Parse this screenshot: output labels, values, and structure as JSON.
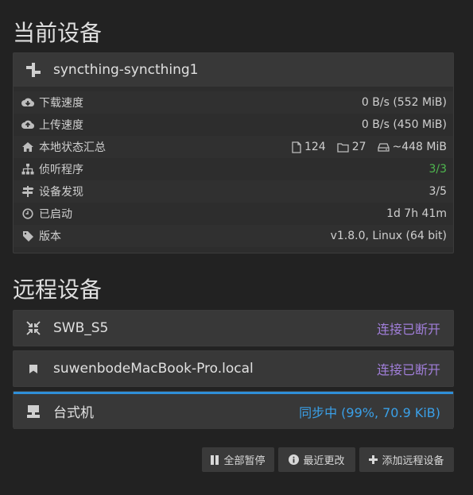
{
  "this_device": {
    "section_title": "当前设备",
    "name": "syncthing-syncthing1",
    "rows": [
      {
        "icon": "cloud-download-icon",
        "label": "下载速度",
        "value": "0 B/s (552 MiB)"
      },
      {
        "icon": "cloud-upload-icon",
        "label": "上传速度",
        "value": "0 B/s (450 MiB)"
      },
      {
        "icon": "home-icon",
        "label": "本地状态汇总",
        "files": "124",
        "folders": "27",
        "size": "~448 MiB"
      },
      {
        "icon": "sitemap-icon",
        "label": "侦听程序",
        "value": "3/3"
      },
      {
        "icon": "signpost-icon",
        "label": "设备发现",
        "value": "3/5"
      },
      {
        "icon": "clock-icon",
        "label": "已启动",
        "value": "1d 7h 41m"
      },
      {
        "icon": "tag-icon",
        "label": "版本",
        "value": "v1.8.0, Linux (64 bit)"
      }
    ]
  },
  "remote_devices": {
    "section_title": "远程设备",
    "devices": [
      {
        "name": "SWB_S5",
        "status": "连接已断开",
        "status_color": "#a07ed8",
        "icon": "compress-icon"
      },
      {
        "name": "suwenbodeMacBook-Pro.local",
        "status": "连接已断开",
        "status_color": "#a07ed8",
        "icon": "bookmark-icon"
      },
      {
        "name": "台式机",
        "status": "同步中 (99%, 70.9 KiB)",
        "status_color": "#3aa0e8",
        "icon": "desktop-icon",
        "sync_progress": 0.99
      }
    ]
  },
  "actions": {
    "pause_all": "全部暂停",
    "recent_changes": "最近更改",
    "add_remote": "添加远程设备"
  },
  "colors": {
    "background": "#222222",
    "panel": "#2d2d2d",
    "green": "#4fb84f",
    "purple": "#a07ed8",
    "blue": "#3aa0e8"
  }
}
